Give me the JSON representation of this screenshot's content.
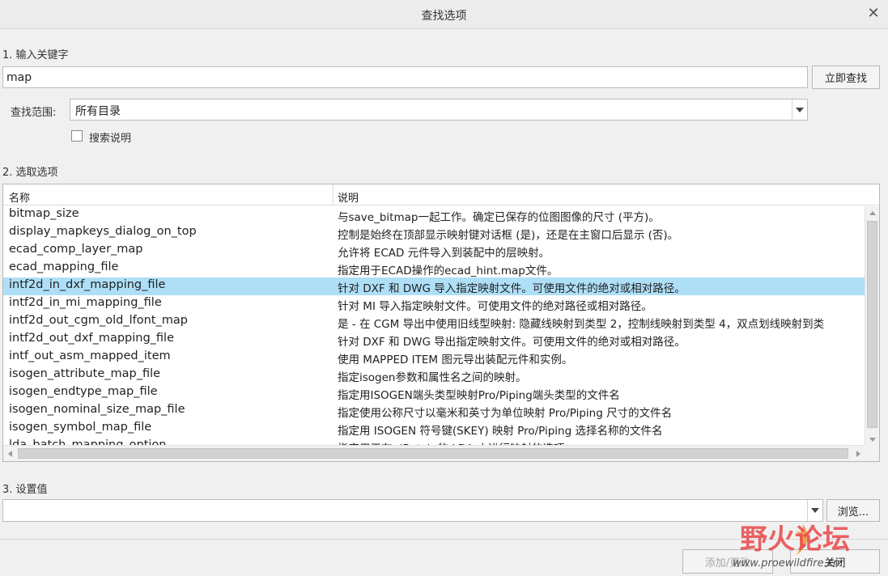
{
  "window": {
    "title": "查找选项",
    "close_glyph": "✕"
  },
  "step1": {
    "label": "1. 输入关键字",
    "keyword": "map",
    "search_button": "立即查找",
    "scope_label": "查找范围:",
    "scope_value": "所有目录",
    "search_desc_label": "搜索说明",
    "search_desc_checked": false
  },
  "step2": {
    "label": "2. 选取选项",
    "columns": [
      "名称",
      "说明"
    ],
    "rows": [
      [
        "bitmap_size",
        "与save_bitmap一起工作。确定已保存的位图图像的尺寸 (平方)。"
      ],
      [
        "display_mapkeys_dialog_on_top",
        "控制是始终在顶部显示映射键对话框 (是)，还是在主窗口后显示 (否)。"
      ],
      [
        "ecad_comp_layer_map",
        "允许将 ECAD 元件导入到装配中的层映射。"
      ],
      [
        "ecad_mapping_file",
        "指定用于ECAD操作的ecad_hint.map文件。"
      ],
      [
        "intf2d_in_dxf_mapping_file",
        "针对 DXF 和 DWG 导入指定映射文件。可使用文件的绝对或相对路径。"
      ],
      [
        "intf2d_in_mi_mapping_file",
        "针对 MI 导入指定映射文件。可使用文件的绝对路径或相对路径。"
      ],
      [
        "intf2d_out_cgm_old_lfont_map",
        "是 - 在 CGM 导出中使用旧线型映射: 隐藏线映射到类型 2，控制线映射到类型 4，双点划线映射到类"
      ],
      [
        "intf2d_out_dxf_mapping_file",
        "针对 DXF 和 DWG 导出指定映射文件。可使用文件的绝对或相对路径。"
      ],
      [
        "intf_out_asm_mapped_item",
        "使用 MAPPED ITEM 图元导出装配元件和实例。"
      ],
      [
        "isogen_attribute_map_file",
        "指定isogen参数和属性名之间的映射。"
      ],
      [
        "isogen_endtype_map_file",
        "指定用ISOGEN端头类型映射Pro/Piping端头类型的文件名"
      ],
      [
        "isogen_nominal_size_map_file",
        "指定使用公称尺寸以毫米和英寸为单位映射 Pro/Piping 尺寸的文件名"
      ],
      [
        "isogen_symbol_map_file",
        "指定用 ISOGEN 符号键(SKEY) 映射 Pro/Piping 选择名称的文件名"
      ],
      [
        "lda_batch_mapping_option",
        "指定用于在 dBatch 的 LDA 中进行映射的选项"
      ]
    ],
    "selected_index": 4,
    "selected_color": "#aedff7"
  },
  "step3": {
    "label": "3. 设置值",
    "value": "",
    "browse_button": "浏览..."
  },
  "footer": {
    "add_change_button": "添加/更改",
    "close_button": "关闭"
  },
  "watermark": {
    "title": "野火论坛",
    "url": "www.proewildfire.cn"
  }
}
